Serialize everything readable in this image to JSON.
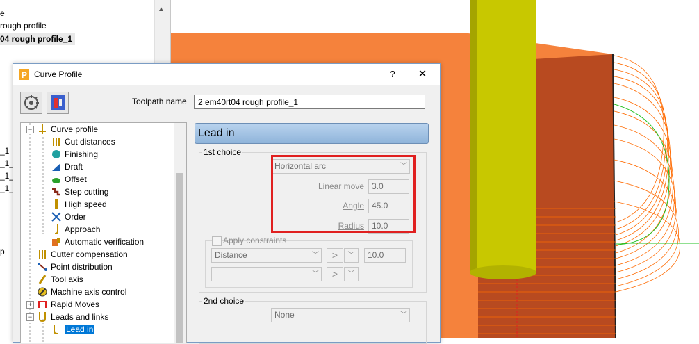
{
  "explorer": {
    "rows": [
      "e",
      "rough profile",
      "04 rough profile_1",
      "_1",
      "_1_1",
      "_1_1",
      "_1_1",
      "p"
    ]
  },
  "dialog": {
    "title": "Curve Profile",
    "help": "?",
    "close": "✕",
    "toolpath_name_label": "Toolpath name",
    "toolpath_name_value": "2 em40rt04 rough profile_1"
  },
  "tree": {
    "items": [
      {
        "label": "Curve profile",
        "icon": "curve-profile-icon"
      },
      {
        "label": "Cut distances",
        "icon": "cut-distances-icon"
      },
      {
        "label": "Finishing",
        "icon": "finishing-icon"
      },
      {
        "label": "Draft",
        "icon": "draft-icon"
      },
      {
        "label": "Offset",
        "icon": "offset-icon"
      },
      {
        "label": "Step cutting",
        "icon": "step-cutting-icon"
      },
      {
        "label": "High speed",
        "icon": "high-speed-icon"
      },
      {
        "label": "Order",
        "icon": "order-icon"
      },
      {
        "label": "Approach",
        "icon": "approach-icon"
      },
      {
        "label": "Automatic verification",
        "icon": "automatic-verification-icon"
      },
      {
        "label": "Cutter compensation",
        "icon": "cutter-compensation-icon"
      },
      {
        "label": "Point distribution",
        "icon": "point-distribution-icon"
      },
      {
        "label": "Tool axis",
        "icon": "tool-axis-icon"
      },
      {
        "label": "Machine axis control",
        "icon": "machine-axis-control-icon"
      },
      {
        "label": "Rapid Moves",
        "icon": "rapid-moves-icon"
      },
      {
        "label": "Leads and links",
        "icon": "leads-and-links-icon"
      },
      {
        "label": "Lead in",
        "icon": "lead-in-icon"
      }
    ]
  },
  "page": {
    "header": "Lead in",
    "first_choice": {
      "label": "1st choice",
      "type_value": "Horizontal arc",
      "linear_move_label": "Linear move",
      "linear_move_value": "3.0",
      "angle_label": "Angle",
      "angle_value": "45.0",
      "radius_label": "Radius",
      "radius_value": "10.0"
    },
    "constraints": {
      "label": "Apply constraints",
      "row1_type": "Distance",
      "row1_op": ">",
      "row1_value": "10.0",
      "row2_type": "",
      "row2_op": ">"
    },
    "second_choice": {
      "label": "2nd choice",
      "type_value": "None"
    }
  },
  "colors": {
    "highlight": "#e02020",
    "selection": "#0078d7",
    "tool_yellow": "#c8c800",
    "stock_orange": "#f5823c"
  }
}
